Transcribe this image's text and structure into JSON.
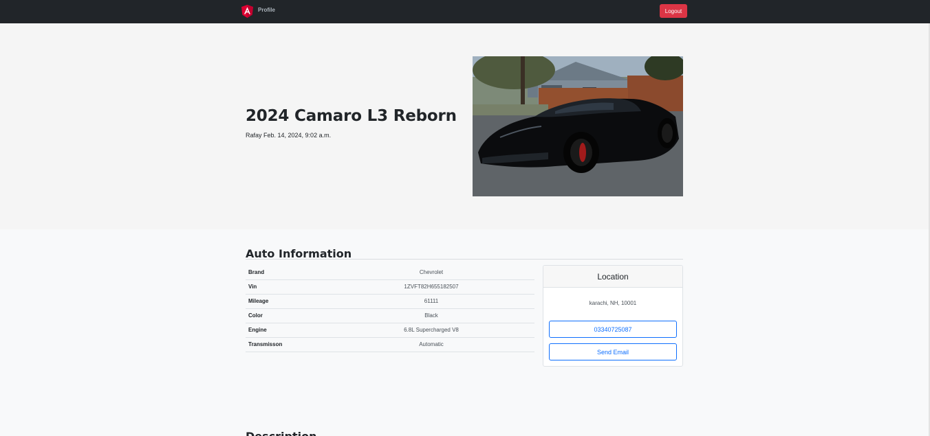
{
  "navbar": {
    "logo_icon": "angular-logo-icon",
    "profile_label": "Profile",
    "logout_label": "Logout",
    "logout_color": "#dc3545"
  },
  "hero": {
    "title": "2024 Camaro L3 Reborn",
    "meta": "Rafay Feb. 14, 2024, 9:02 a.m."
  },
  "auto_info": {
    "title": "Auto Information",
    "rows": [
      {
        "key": "Brand",
        "value": "Chevrolet"
      },
      {
        "key": "Vin",
        "value": "1ZVFT82H655182507"
      },
      {
        "key": "Mileage",
        "value": "61111"
      },
      {
        "key": "Color",
        "value": "Black"
      },
      {
        "key": "Engine",
        "value": "6.8L Supercharged V8"
      },
      {
        "key": "Transmisson",
        "value": "Automatic"
      }
    ]
  },
  "location": {
    "header": "Location",
    "address": "karachi, NH, 10001",
    "phone_label": "03340725087",
    "email_label": "Send Email",
    "button_color": "#0d6efd"
  },
  "description": {
    "title": "Description"
  }
}
